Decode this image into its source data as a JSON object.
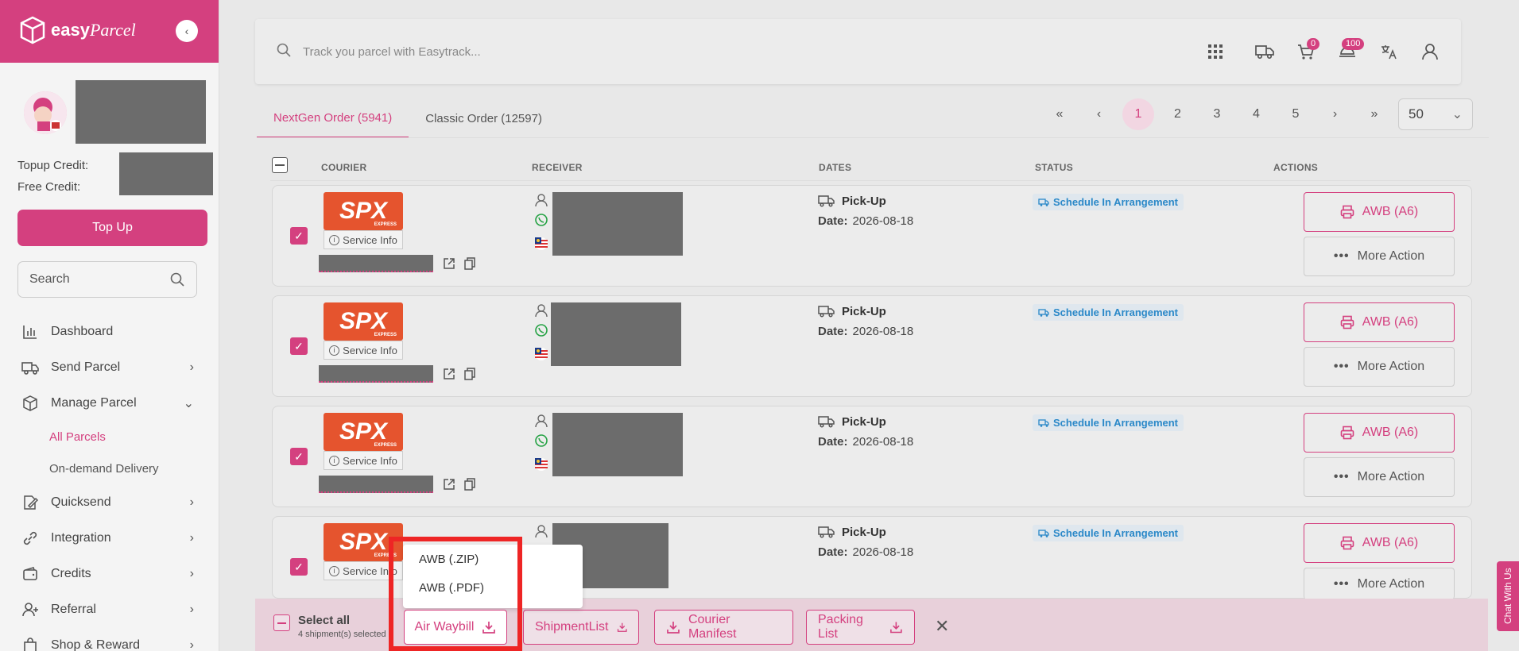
{
  "brand": {
    "name": "easy",
    "name_italic": "Parcel",
    "accent": "#d4407f"
  },
  "sidebar": {
    "topup_credit_label": "Topup Credit:",
    "free_credit_label": "Free Credit:",
    "topup_button": "Top Up",
    "search_placeholder": "Search",
    "items": [
      {
        "label": "Dashboard",
        "icon": "chart-icon"
      },
      {
        "label": "Send Parcel",
        "icon": "truck-icon"
      },
      {
        "label": "Manage Parcel",
        "icon": "box-icon"
      },
      {
        "label": "All Parcels"
      },
      {
        "label": "On-demand Delivery"
      },
      {
        "label": "Quicksend",
        "icon": "edit-icon"
      },
      {
        "label": "Integration",
        "icon": "link-icon"
      },
      {
        "label": "Credits",
        "icon": "wallet-icon"
      },
      {
        "label": "Referral",
        "icon": "user-plus-icon"
      },
      {
        "label": "Shop & Reward",
        "icon": "bag-icon"
      }
    ]
  },
  "topbar": {
    "track_placeholder": "Track you parcel with Easytrack...",
    "cart_count": "0",
    "notif_count": "100"
  },
  "tabs": [
    {
      "label": "NextGen Order (5941)"
    },
    {
      "label": "Classic Order (12597)"
    }
  ],
  "pagination": {
    "pages": [
      "1",
      "2",
      "3",
      "4",
      "5"
    ],
    "current": "1",
    "per_page": "50"
  },
  "table": {
    "headers": {
      "courier": "COURIER",
      "receiver": "RECEIVER",
      "dates": "DATES",
      "status": "STATUS",
      "actions": "ACTIONS"
    },
    "rows": [
      {
        "courier": "SPX",
        "courier_sub": "EXPRESS",
        "service_info": "Service Info",
        "pickup_label": "Pick-Up",
        "date_label": "Date:",
        "date": "2026-08-18",
        "status": "Schedule In Arrangement",
        "awb": "AWB (A6)",
        "more": "More Action"
      },
      {
        "courier": "SPX",
        "courier_sub": "EXPRESS",
        "service_info": "Service Info",
        "pickup_label": "Pick-Up",
        "date_label": "Date:",
        "date": "2026-08-18",
        "status": "Schedule In Arrangement",
        "awb": "AWB (A6)",
        "more": "More Action"
      },
      {
        "courier": "SPX",
        "courier_sub": "EXPRESS",
        "service_info": "Service Info",
        "pickup_label": "Pick-Up",
        "date_label": "Date:",
        "date": "2026-08-18",
        "status": "Schedule In Arrangement",
        "awb": "AWB (A6)",
        "more": "More Action"
      },
      {
        "courier": "SPX",
        "courier_sub": "EXPRESS",
        "service_info": "Service Info",
        "pickup_label": "Pick-Up",
        "date_label": "Date:",
        "date": "2026-08-18",
        "status": "Schedule In Arrangement",
        "awb": "AWB (A6)",
        "more": "More Action"
      }
    ]
  },
  "actionbar": {
    "select_all": "Select all",
    "selected_count": "4 shipment(s) selected",
    "air_waybill": "Air Waybill",
    "shipment_list": "ShipmentList",
    "courier_manifest": "Courier Manifest",
    "packing_list": "Packing List",
    "close": "✕"
  },
  "dropdown": {
    "items": [
      "AWB (.ZIP)",
      "AWB (.PDF)"
    ]
  },
  "chat": {
    "label": "Chat With Us"
  },
  "colors": {
    "status_blue": "#2a88c8",
    "highlight_red": "#ee2525"
  }
}
